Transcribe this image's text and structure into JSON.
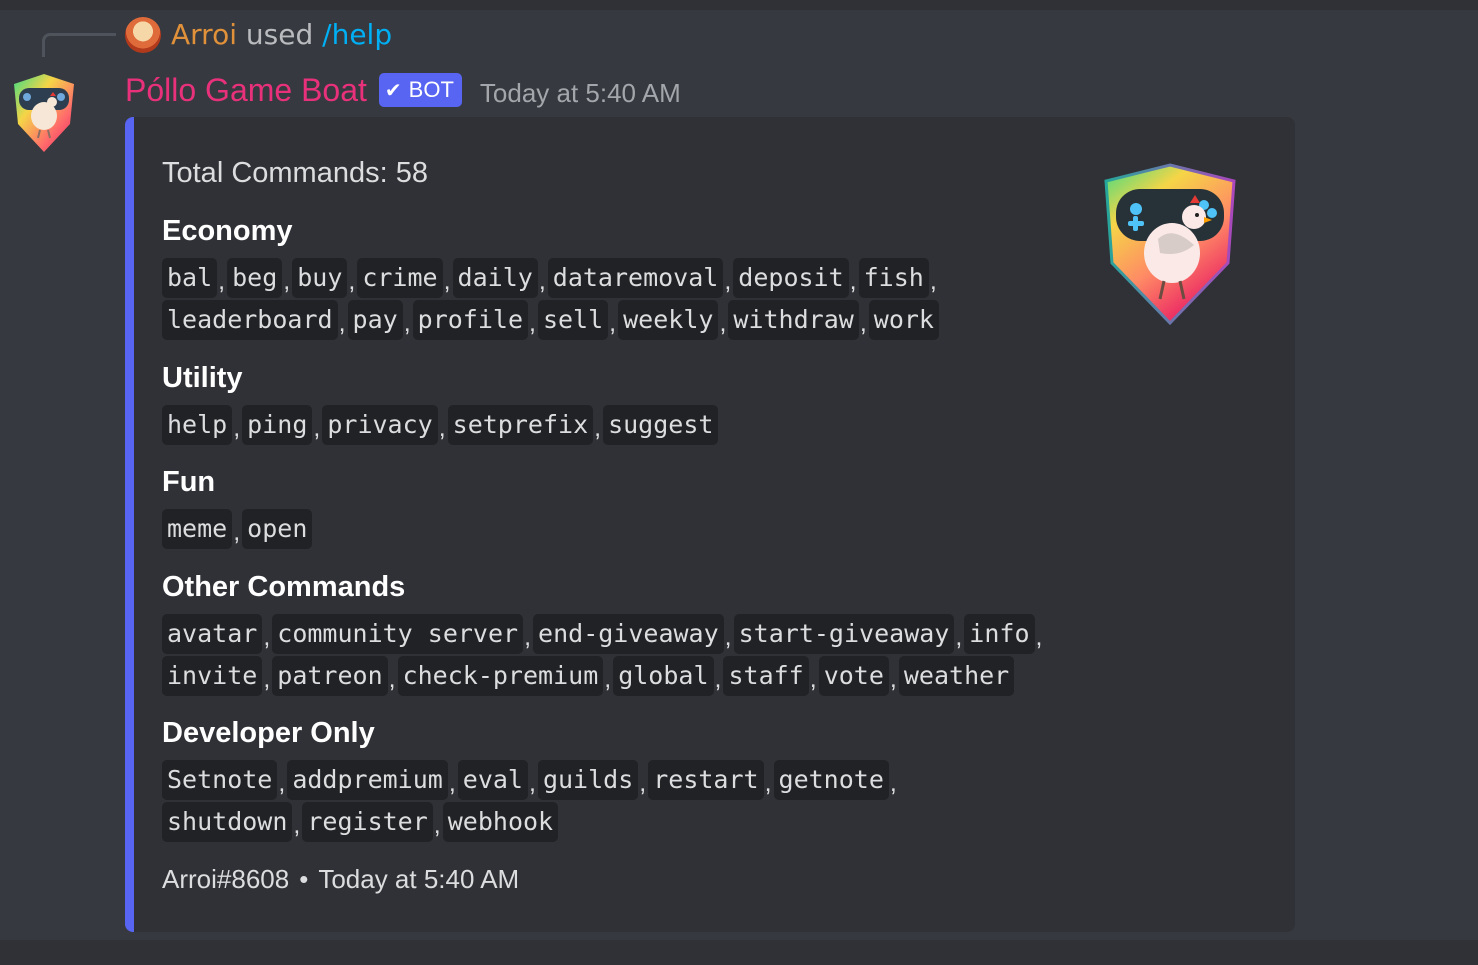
{
  "reply": {
    "username": "Arroi",
    "used_text": "used",
    "command": "/help"
  },
  "message": {
    "username": "Póllo Game Boat",
    "bot_tag": "BOT",
    "timestamp": "Today at 5:40 AM",
    "username_color": "#e9317b",
    "accent_color": "#5865f2"
  },
  "embed": {
    "description": "Total Commands: 58",
    "fields": [
      {
        "title": "Economy",
        "lines": [
          [
            "bal",
            "beg",
            "buy",
            "crime",
            "daily",
            "dataremoval",
            "deposit",
            "fish"
          ],
          [
            "leaderboard",
            "pay",
            "profile",
            "sell",
            "weekly",
            "withdraw",
            "work"
          ]
        ]
      },
      {
        "title": "Utility",
        "lines": [
          [
            "help",
            "ping",
            "privacy",
            "setprefix",
            "suggest"
          ]
        ]
      },
      {
        "title": "Fun",
        "lines": [
          [
            "meme",
            "open"
          ]
        ]
      },
      {
        "title": "Other Commands",
        "lines": [
          [
            "avatar",
            "community server",
            "end-giveaway",
            "start-giveaway",
            "info"
          ],
          [
            "invite",
            "patreon",
            "check-premium",
            "global",
            "staff",
            "vote",
            "weather"
          ]
        ]
      },
      {
        "title": "Developer Only",
        "lines": [
          [
            "Setnote",
            "addpremium",
            "eval",
            "guilds",
            "restart",
            "getnote"
          ],
          [
            "shutdown",
            "register",
            "webhook"
          ]
        ]
      }
    ],
    "footer": {
      "author": "Arroi#8608",
      "separator": "•",
      "timestamp": "Today at 5:40 AM"
    }
  },
  "icons": [
    "chicken-gamepad-shield-icon",
    "verified-check-icon"
  ]
}
